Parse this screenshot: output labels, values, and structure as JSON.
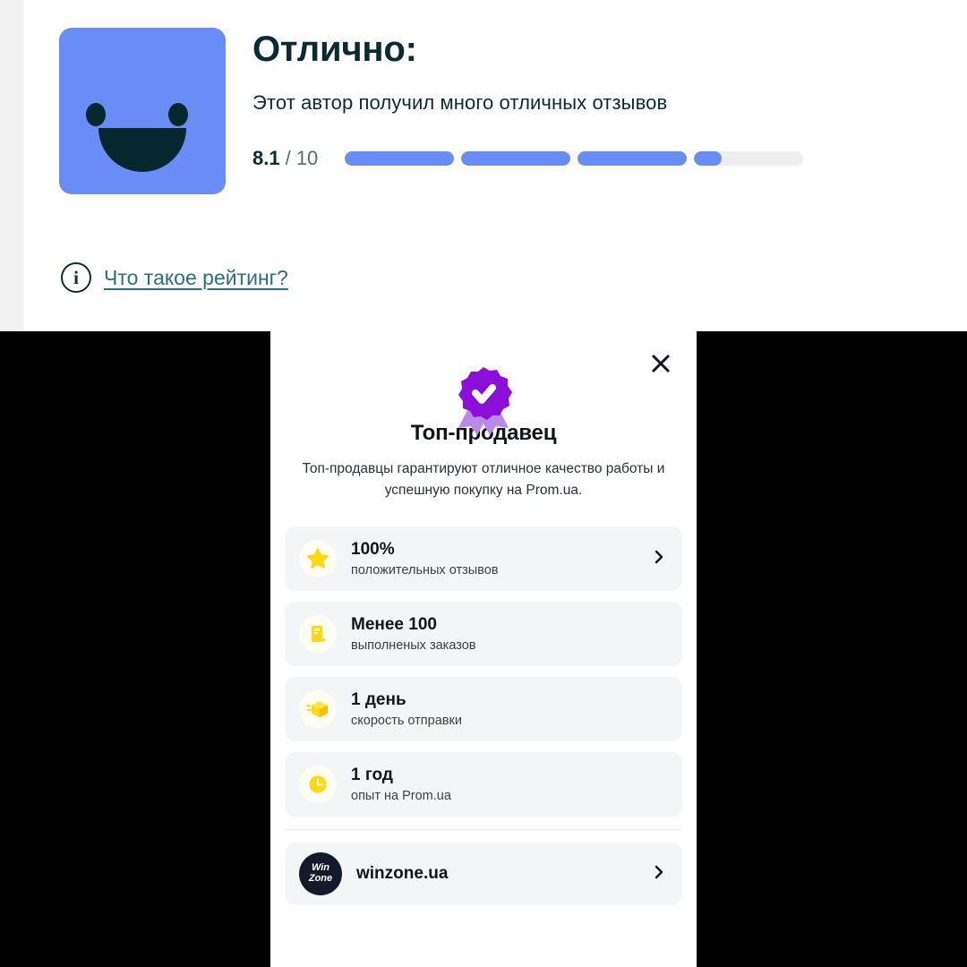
{
  "rating_panel": {
    "smiley_icon": "smiley-face-icon",
    "title": "Отлично:",
    "subtitle": "Этот автор получил много отличных отзывов",
    "score_value": "8.1",
    "score_max": "/ 10",
    "score_numeric": 8.1,
    "score_scale": 10,
    "segments": [
      100,
      100,
      100,
      25
    ],
    "info_icon": "info-icon",
    "what_is_rating_link": "Что такое рейтинг?",
    "colors": {
      "accent_blue": "#6a8cf5",
      "track_gray": "#eeeeef",
      "text_dark": "#0b2b33",
      "link_teal": "#2a6f79"
    }
  },
  "modal": {
    "close_icon": "close-icon",
    "badge_icon": "verified-rosette-icon",
    "title": "Топ-продавец",
    "description": "Топ-продавцы гарантируют отличное качество работы и успешную покупку на Prom.ua.",
    "cards": [
      {
        "icon": "star-icon",
        "value": "100%",
        "label": "положительных отзывов",
        "has_chevron": true
      },
      {
        "icon": "receipt-icon",
        "value": "Менее 100",
        "label": "выполненых заказов",
        "has_chevron": false
      },
      {
        "icon": "package-box-icon",
        "value": "1 день",
        "label": "скорость отправки",
        "has_chevron": false
      },
      {
        "icon": "clock-icon",
        "value": "1 год",
        "label": "опыт на Prom.ua",
        "has_chevron": false
      }
    ],
    "seller": {
      "avatar_icon": "winzone-avatar",
      "avatar_line1": "Win",
      "avatar_line2": "Zone",
      "name": "winzone.ua",
      "has_chevron": true
    },
    "colors": {
      "badge_purple": "#8b0fd9",
      "badge_ribbon": "#bb8ae8",
      "card_bg": "#f4f5f7",
      "icon_yellow": "#ffd814"
    }
  }
}
